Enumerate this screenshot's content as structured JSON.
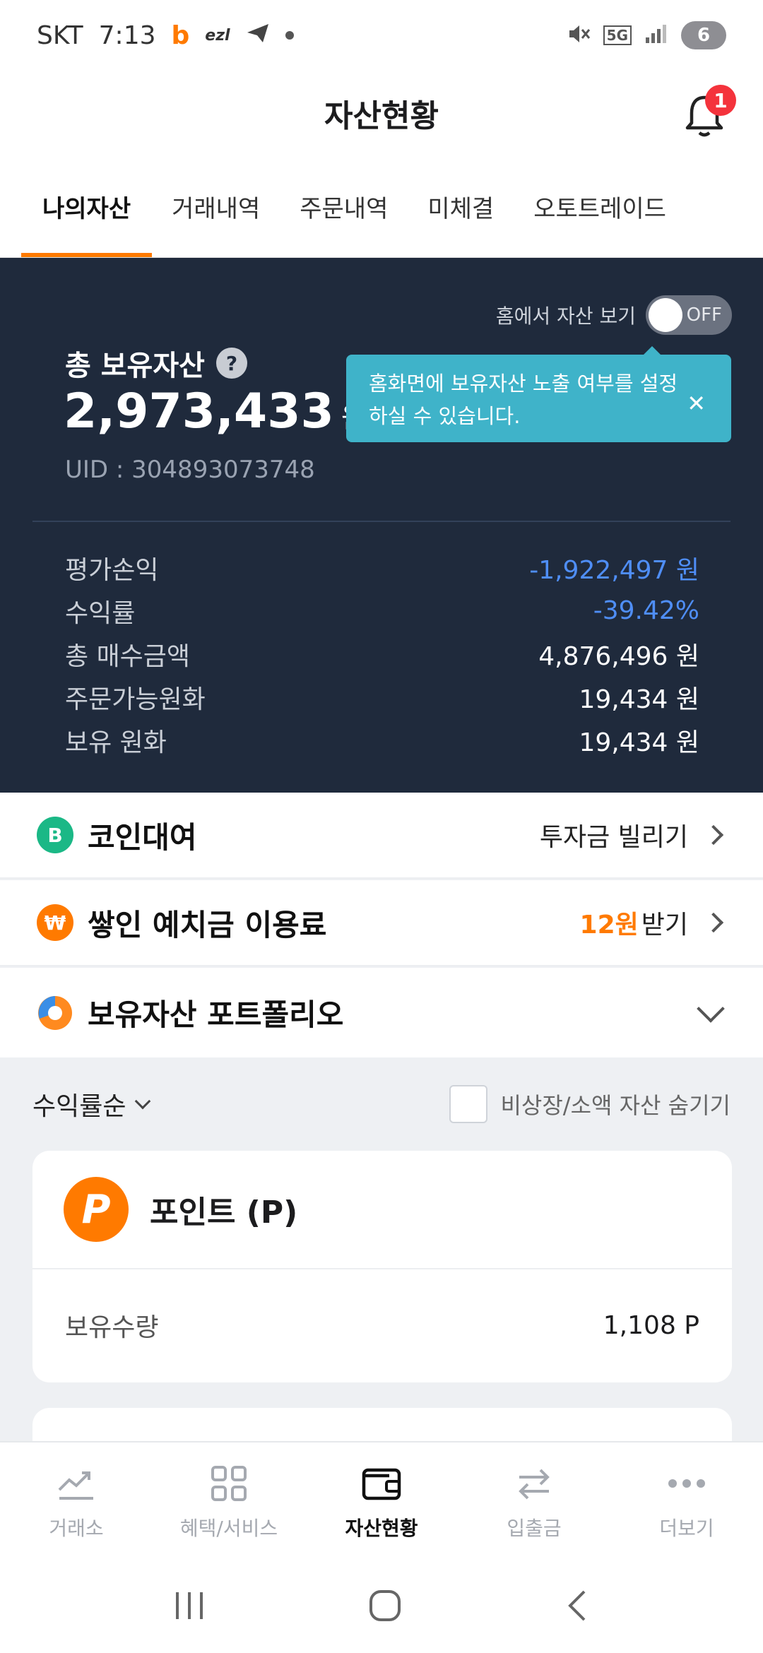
{
  "status_bar": {
    "carrier": "SKT",
    "time": "7:13",
    "app_badge": "b",
    "ezl_label": "ezl",
    "network": "5G",
    "battery": "6"
  },
  "header": {
    "title": "자산현황",
    "notification_count": "1"
  },
  "tabs": [
    {
      "label": "나의자산",
      "active": true
    },
    {
      "label": "거래내역",
      "active": false
    },
    {
      "label": "주문내역",
      "active": false
    },
    {
      "label": "미체결",
      "active": false
    },
    {
      "label": "오토트레이드",
      "active": false
    }
  ],
  "summary": {
    "home_toggle_label": "홈에서 자산 보기",
    "toggle_state": "OFF",
    "total_label": "총 보유자산",
    "help_icon": "?",
    "total_amount": "2,973,433",
    "currency_unit": "원",
    "uid": "UID : 304893073748",
    "tooltip_text": "홈화면에 보유자산 노출 여부를 설정하실 수 있습니다.",
    "tooltip_close": "✕",
    "rows": [
      {
        "label": "평가손익",
        "value": "-1,922,497 원"
      },
      {
        "label": "수익률",
        "value": "-39.42%"
      },
      {
        "label": "총 매수금액",
        "value": "4,876,496 원"
      },
      {
        "label": "주문가능원화",
        "value": "19,434 원"
      },
      {
        "label": "보유 원화",
        "value": "19,434 원"
      }
    ]
  },
  "coin_loan": {
    "label": "코인대여",
    "action": "투자금 빌리기",
    "icon": "B"
  },
  "deposit_fee": {
    "label": "쌓인 예치금 이용료",
    "amount": "12원",
    "action": "받기",
    "icon": "₩"
  },
  "portfolio": {
    "label": "보유자산 포트폴리오"
  },
  "filter": {
    "sort_label": "수익률순",
    "hide_label": "비상장/소액 자산 숨기기"
  },
  "point_card": {
    "logo": "P",
    "title": "포인트 (P)",
    "qty_label": "보유수량",
    "qty_value": "1,108 P"
  },
  "bottom_nav": [
    {
      "label": "거래소",
      "icon": "chart-trend-icon",
      "active": false
    },
    {
      "label": "혜택/서비스",
      "icon": "grid-icon",
      "active": false
    },
    {
      "label": "자산현황",
      "icon": "wallet-icon",
      "active": true
    },
    {
      "label": "입출금",
      "icon": "transfer-arrows-icon",
      "active": false
    },
    {
      "label": "더보기",
      "icon": "more-dots-icon",
      "active": false
    }
  ],
  "colors": {
    "accent": "#ff7a00",
    "panel_bg": "#1f2a3c",
    "negative_blue": "#4f8ef7",
    "tooltip_bg": "#3fb3c9"
  }
}
